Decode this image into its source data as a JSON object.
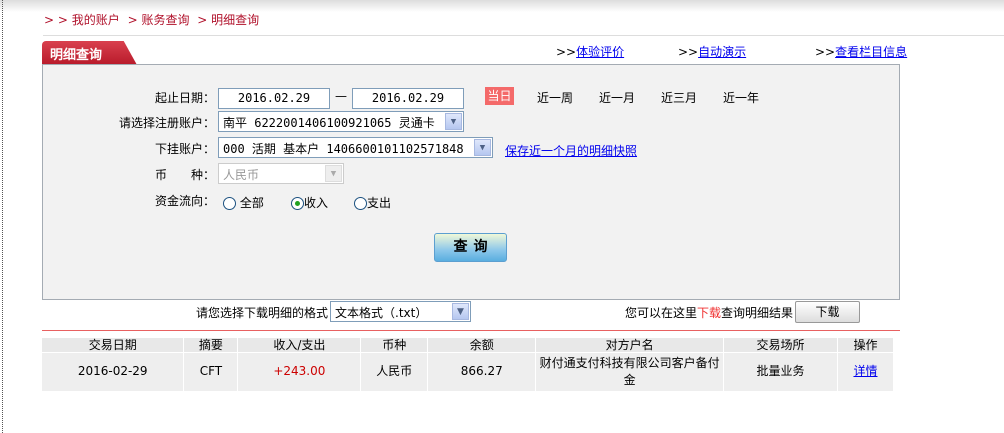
{
  "breadcrumb": [
    "> > 我的账户",
    "> 账务查询",
    "> 明细查询"
  ],
  "tab_title": "明细查询",
  "top_links": [
    {
      "prefix": ">>",
      "label": "体验评价"
    },
    {
      "prefix": ">>",
      "label": "自动演示"
    },
    {
      "prefix": ">>",
      "label": "查看栏目信息"
    }
  ],
  "form": {
    "date_label": "起止日期：",
    "start_date": "2016.02.29",
    "sep": "—",
    "end_date": "2016.02.29",
    "quick_ranges": [
      "当日",
      "近一周",
      "近一月",
      "近三月",
      "近一年"
    ],
    "quick_selected": "当日",
    "account_label": "请选择注册账户：",
    "account_value": "南平 6222001406100921065 灵通卡",
    "sub_label": "下挂账户：",
    "sub_value": "000 活期 基本户 1406600101102571848",
    "snapshot_link": "保存近一个月的明细快照",
    "currency_label": "币　　种：",
    "currency_value": "人民币",
    "flow_label": "资金流向：",
    "flow_options": [
      "全部",
      "收入",
      "支出"
    ],
    "flow_selected": "收入",
    "query_button": "查询"
  },
  "download": {
    "format_label": "请您选择下载明细的格式",
    "format_value": "文本格式（.txt）",
    "hint_pre": "您可以在这里",
    "hint_red": "下载",
    "hint_post": "查询明细结果",
    "button": "下载"
  },
  "table": {
    "headers": [
      "交易日期",
      "摘要",
      "收入/支出",
      "币种",
      "余额",
      "对方户名",
      "交易场所",
      "操作"
    ],
    "rows": [
      [
        "2016-02-29",
        "CFT",
        "+243.00",
        "人民币",
        "866.27",
        "财付通支付科技有限公司客户备付金",
        "批量业务",
        "详情"
      ]
    ]
  },
  "colors": {
    "brand_red": "#b81a2a",
    "income_red": "#cc0000",
    "link_blue": "#0000ee"
  }
}
